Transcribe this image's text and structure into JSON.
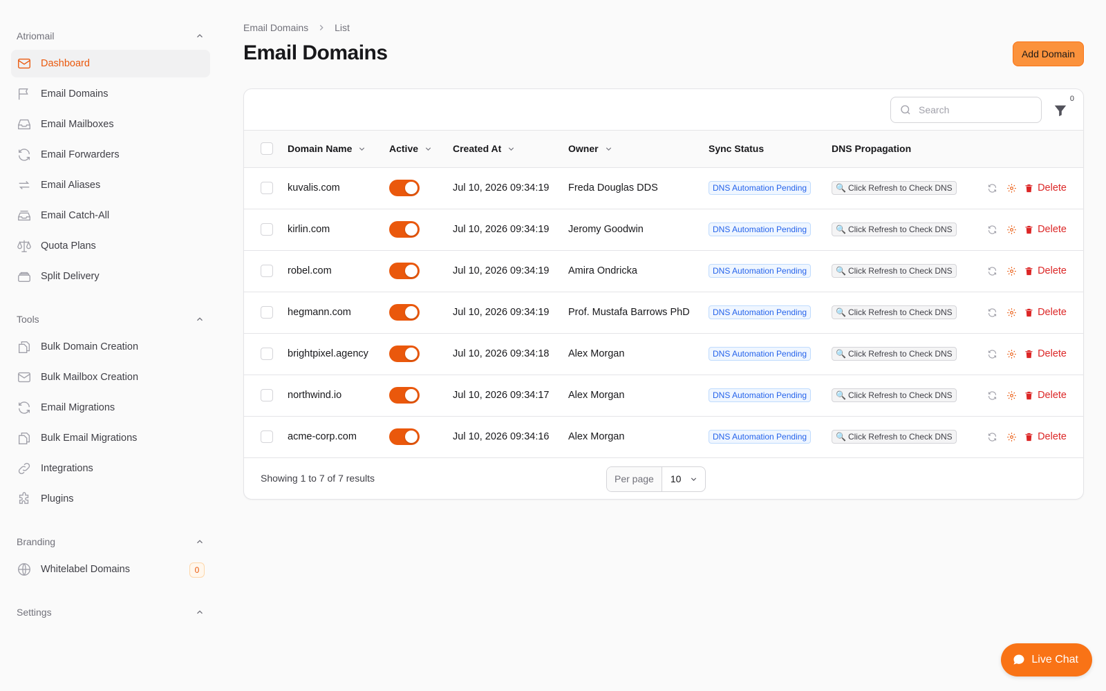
{
  "sidebar": {
    "groups": [
      {
        "label": "Atriomail",
        "items": [
          {
            "label": "Dashboard",
            "icon": "envelope-icon",
            "active": true
          },
          {
            "label": "Email Domains",
            "icon": "flag-icon"
          },
          {
            "label": "Email Mailboxes",
            "icon": "inbox-icon"
          },
          {
            "label": "Email Forwarders",
            "icon": "refresh-icon"
          },
          {
            "label": "Email Aliases",
            "icon": "arrows-icon"
          },
          {
            "label": "Email Catch-All",
            "icon": "inbox-stack-icon"
          },
          {
            "label": "Quota Plans",
            "icon": "scale-icon"
          },
          {
            "label": "Split Delivery",
            "icon": "stack-icon"
          }
        ]
      },
      {
        "label": "Tools",
        "items": [
          {
            "label": "Bulk Domain Creation",
            "icon": "documents-icon"
          },
          {
            "label": "Bulk Mailbox Creation",
            "icon": "envelope-icon"
          },
          {
            "label": "Email Migrations",
            "icon": "refresh-icon"
          },
          {
            "label": "Bulk Email Migrations",
            "icon": "documents-icon"
          },
          {
            "label": "Integrations",
            "icon": "link-icon"
          },
          {
            "label": "Plugins",
            "icon": "puzzle-icon"
          }
        ]
      },
      {
        "label": "Branding",
        "items": [
          {
            "label": "Whitelabel Domains",
            "icon": "globe-icon",
            "badge": "0"
          }
        ]
      },
      {
        "label": "Settings",
        "items": []
      }
    ]
  },
  "breadcrumb": {
    "parent": "Email Domains",
    "current": "List"
  },
  "page": {
    "title": "Email Domains",
    "add_button": "Add Domain"
  },
  "toolbar": {
    "search_placeholder": "Search",
    "filter_count": "0"
  },
  "table": {
    "columns": [
      "Domain Name",
      "Active",
      "Created At",
      "Owner",
      "Sync Status",
      "DNS Propagation"
    ],
    "rows": [
      {
        "domain": "kuvalis.com",
        "active": true,
        "created": "Jul 10, 2026 09:34:19",
        "owner": "Freda Douglas DDS",
        "sync": "DNS Automation Pending",
        "dns": "Click Refresh to Check DNS",
        "delete": "Delete"
      },
      {
        "domain": "kirlin.com",
        "active": true,
        "created": "Jul 10, 2026 09:34:19",
        "owner": "Jeromy Goodwin",
        "sync": "DNS Automation Pending",
        "dns": "Click Refresh to Check DNS",
        "delete": "Delete"
      },
      {
        "domain": "robel.com",
        "active": true,
        "created": "Jul 10, 2026 09:34:19",
        "owner": "Amira Ondricka",
        "sync": "DNS Automation Pending",
        "dns": "Click Refresh to Check DNS",
        "delete": "Delete"
      },
      {
        "domain": "hegmann.com",
        "active": true,
        "created": "Jul 10, 2026 09:34:19",
        "owner": "Prof. Mustafa Barrows PhD",
        "sync": "DNS Automation Pending",
        "dns": "Click Refresh to Check DNS",
        "delete": "Delete"
      },
      {
        "domain": "brightpixel.agency",
        "active": true,
        "created": "Jul 10, 2026 09:34:18",
        "owner": "Alex Morgan",
        "sync": "DNS Automation Pending",
        "dns": "Click Refresh to Check DNS",
        "delete": "Delete"
      },
      {
        "domain": "northwind.io",
        "active": true,
        "created": "Jul 10, 2026 09:34:17",
        "owner": "Alex Morgan",
        "sync": "DNS Automation Pending",
        "dns": "Click Refresh to Check DNS",
        "delete": "Delete"
      },
      {
        "domain": "acme-corp.com",
        "active": true,
        "created": "Jul 10, 2026 09:34:16",
        "owner": "Alex Morgan",
        "sync": "DNS Automation Pending",
        "dns": "Click Refresh to Check DNS",
        "delete": "Delete"
      }
    ]
  },
  "footer": {
    "showing": "Showing 1 to 7 of 7 results",
    "per_page_label": "Per page",
    "per_page_value": "10"
  },
  "live_chat": {
    "label": "Live Chat"
  },
  "colors": {
    "accent": "#ea580c",
    "button": "#fb923c",
    "sync_badge": "#2563eb",
    "delete": "#dc2626"
  }
}
